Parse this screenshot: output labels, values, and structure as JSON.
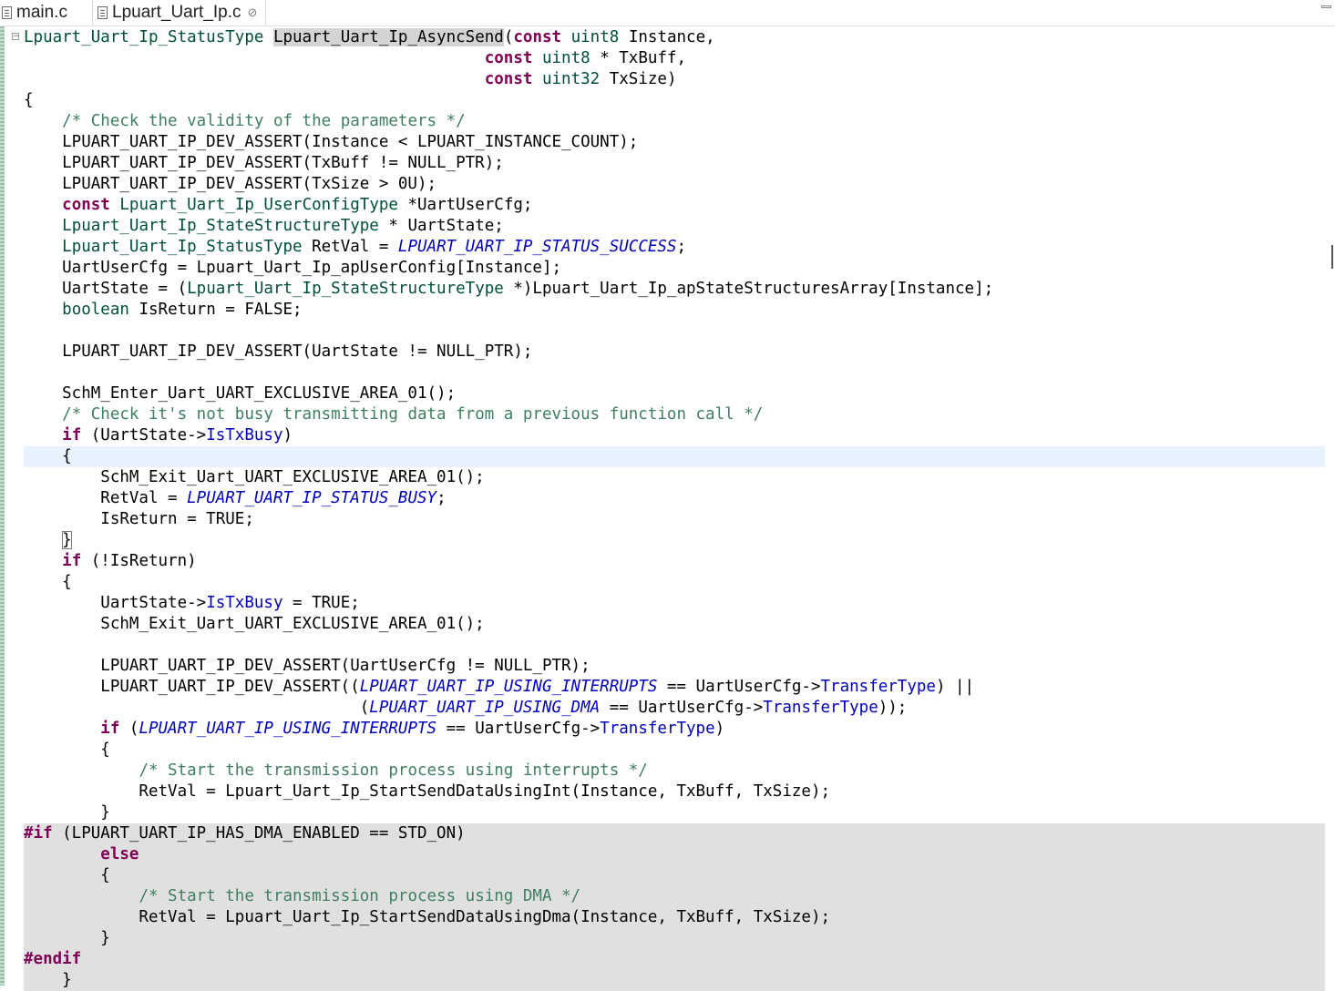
{
  "tabs": [
    {
      "label": "main.c",
      "active": false
    },
    {
      "label": "Lpuart_Uart_Ip.c",
      "active": true,
      "close": "⊘"
    }
  ],
  "colors": {
    "keyword": "#7f0055",
    "type": "#005032",
    "comment": "#3f7f5f",
    "macro": "#0000c0",
    "current_line": "#e8f2fe",
    "inactive_code": "#e0e0e0"
  },
  "editor": {
    "line_style": {
      "cursor_line_index": 20,
      "inactive_line_range": [
        38,
        45
      ]
    },
    "lines": [
      [
        [
          "ty",
          "Lpuart_Uart_Ip_StatusType"
        ],
        [
          "t",
          " "
        ],
        [
          "sel",
          "Lpuart_Uart_Ip_AsyncSend"
        ],
        [
          "t",
          "("
        ],
        [
          "kw",
          "const"
        ],
        [
          "t",
          " "
        ],
        [
          "ty",
          "uint8"
        ],
        [
          "t",
          " Instance,"
        ]
      ],
      [
        [
          "t",
          "                                                "
        ],
        [
          "kw",
          "const"
        ],
        [
          "t",
          " "
        ],
        [
          "ty",
          "uint8"
        ],
        [
          "t",
          " * TxBuff,"
        ]
      ],
      [
        [
          "t",
          "                                                "
        ],
        [
          "kw",
          "const"
        ],
        [
          "t",
          " "
        ],
        [
          "ty",
          "uint32"
        ],
        [
          "t",
          " TxSize)"
        ]
      ],
      [
        [
          "t",
          "{"
        ]
      ],
      [
        [
          "t",
          "    "
        ],
        [
          "cm",
          "/* Check the validity of the parameters */"
        ]
      ],
      [
        [
          "t",
          "    LPUART_UART_IP_DEV_ASSERT(Instance < LPUART_INSTANCE_COUNT);"
        ]
      ],
      [
        [
          "t",
          "    LPUART_UART_IP_DEV_ASSERT(TxBuff != NULL_PTR);"
        ]
      ],
      [
        [
          "t",
          "    LPUART_UART_IP_DEV_ASSERT(TxSize > 0U);"
        ]
      ],
      [
        [
          "t",
          "    "
        ],
        [
          "kw",
          "const"
        ],
        [
          "t",
          " "
        ],
        [
          "ty",
          "Lpuart_Uart_Ip_UserConfigType"
        ],
        [
          "t",
          " *UartUserCfg;"
        ]
      ],
      [
        [
          "t",
          "    "
        ],
        [
          "ty",
          "Lpuart_Uart_Ip_StateStructureType"
        ],
        [
          "t",
          " * UartState;"
        ]
      ],
      [
        [
          "t",
          "    "
        ],
        [
          "ty",
          "Lpuart_Uart_Ip_StatusType"
        ],
        [
          "t",
          " RetVal = "
        ],
        [
          "mac",
          "LPUART_UART_IP_STATUS_SUCCESS"
        ],
        [
          "t",
          ";"
        ]
      ],
      [
        [
          "t",
          "    UartUserCfg = Lpuart_Uart_Ip_apUserConfig[Instance];"
        ]
      ],
      [
        [
          "t",
          "    UartState = ("
        ],
        [
          "ty",
          "Lpuart_Uart_Ip_StateStructureType"
        ],
        [
          "t",
          " *)Lpuart_Uart_Ip_apStateStructuresArray[Instance];"
        ]
      ],
      [
        [
          "t",
          "    "
        ],
        [
          "ty",
          "boolean"
        ],
        [
          "t",
          " IsReturn = FALSE;"
        ]
      ],
      [
        [
          "t",
          ""
        ]
      ],
      [
        [
          "t",
          "    LPUART_UART_IP_DEV_ASSERT(UartState != NULL_PTR);"
        ]
      ],
      [
        [
          "t",
          ""
        ]
      ],
      [
        [
          "t",
          "    SchM_Enter_Uart_UART_EXCLUSIVE_AREA_01();"
        ]
      ],
      [
        [
          "t",
          "    "
        ],
        [
          "cm",
          "/* Check it's not busy transmitting data from a previous function call */"
        ]
      ],
      [
        [
          "t",
          "    "
        ],
        [
          "kw",
          "if"
        ],
        [
          "t",
          " (UartState->"
        ],
        [
          "fld",
          "IsTxBusy"
        ],
        [
          "t",
          ")"
        ]
      ],
      [
        [
          "t",
          "    {"
        ]
      ],
      [
        [
          "t",
          "        SchM_Exit_Uart_UART_EXCLUSIVE_AREA_01();"
        ]
      ],
      [
        [
          "t",
          "        RetVal = "
        ],
        [
          "mac",
          "LPUART_UART_IP_STATUS_BUSY"
        ],
        [
          "t",
          ";"
        ]
      ],
      [
        [
          "t",
          "        IsReturn = TRUE;"
        ]
      ],
      [
        [
          "t",
          "    "
        ],
        [
          "brk",
          "}"
        ]
      ],
      [
        [
          "t",
          "    "
        ],
        [
          "kw",
          "if"
        ],
        [
          "t",
          " (!IsReturn)"
        ]
      ],
      [
        [
          "t",
          "    {"
        ]
      ],
      [
        [
          "t",
          "        UartState->"
        ],
        [
          "fld",
          "IsTxBusy"
        ],
        [
          "t",
          " = TRUE;"
        ]
      ],
      [
        [
          "t",
          "        SchM_Exit_Uart_UART_EXCLUSIVE_AREA_01();"
        ]
      ],
      [
        [
          "t",
          ""
        ]
      ],
      [
        [
          "t",
          "        LPUART_UART_IP_DEV_ASSERT(UartUserCfg != NULL_PTR);"
        ]
      ],
      [
        [
          "t",
          "        LPUART_UART_IP_DEV_ASSERT(("
        ],
        [
          "mac",
          "LPUART_UART_IP_USING_INTERRUPTS"
        ],
        [
          "t",
          " == UartUserCfg->"
        ],
        [
          "fld",
          "TransferType"
        ],
        [
          "t",
          ") ||"
        ]
      ],
      [
        [
          "t",
          "                                   ("
        ],
        [
          "mac",
          "LPUART_UART_IP_USING_DMA"
        ],
        [
          "t",
          " == UartUserCfg->"
        ],
        [
          "fld",
          "TransferType"
        ],
        [
          "t",
          "));"
        ]
      ],
      [
        [
          "t",
          "        "
        ],
        [
          "kw",
          "if"
        ],
        [
          "t",
          " ("
        ],
        [
          "mac",
          "LPUART_UART_IP_USING_INTERRUPTS"
        ],
        [
          "t",
          " == UartUserCfg->"
        ],
        [
          "fld",
          "TransferType"
        ],
        [
          "t",
          ")"
        ]
      ],
      [
        [
          "t",
          "        {"
        ]
      ],
      [
        [
          "t",
          "            "
        ],
        [
          "cm",
          "/* Start the transmission process using interrupts */"
        ]
      ],
      [
        [
          "t",
          "            RetVal = Lpuart_Uart_Ip_StartSendDataUsingInt(Instance, TxBuff, TxSize);"
        ]
      ],
      [
        [
          "t",
          "        }"
        ]
      ],
      [
        [
          "kw",
          "#if"
        ],
        [
          "t",
          " (LPUART_UART_IP_HAS_DMA_ENABLED == STD_ON)"
        ]
      ],
      [
        [
          "t",
          "        "
        ],
        [
          "kw",
          "else"
        ]
      ],
      [
        [
          "t",
          "        {"
        ]
      ],
      [
        [
          "t",
          "            "
        ],
        [
          "cm",
          "/* Start the transmission process using DMA */"
        ]
      ],
      [
        [
          "t",
          "            RetVal = Lpuart_Uart_Ip_StartSendDataUsingDma(Instance, TxBuff, TxSize);"
        ]
      ],
      [
        [
          "t",
          "        }"
        ]
      ],
      [
        [
          "kw",
          "#endif"
        ]
      ],
      [
        [
          "t",
          "    }"
        ]
      ]
    ]
  }
}
